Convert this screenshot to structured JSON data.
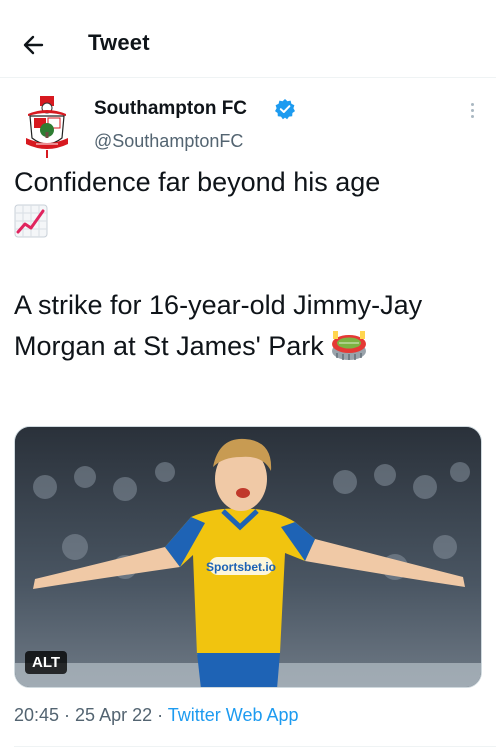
{
  "header": {
    "title": "Tweet",
    "back_icon": "arrow-left-icon"
  },
  "author": {
    "name": "Southampton FC",
    "handle": "@SouthamptonFC",
    "verified": true,
    "avatar_icon": "southampton-crest-icon",
    "verified_icon": "verified-badge-icon"
  },
  "tweet": {
    "line1": "Confidence far beyond his age",
    "line1_emoji": "chart-increasing-icon",
    "line2": "A strike for 16-year-old Jimmy-Jay Morgan at St James' Park",
    "line2_emoji": "stadium-icon"
  },
  "media": {
    "alt_label": "ALT",
    "shirt_sponsor": "Sportsbet.io"
  },
  "meta": {
    "time": "20:45",
    "separator1": " · ",
    "date": "25 Apr 22",
    "separator2": " · ",
    "source": "Twitter Web App"
  },
  "colors": {
    "accent": "#1d9bf0",
    "secondary_text": "#536471",
    "text": "#0f1419"
  }
}
